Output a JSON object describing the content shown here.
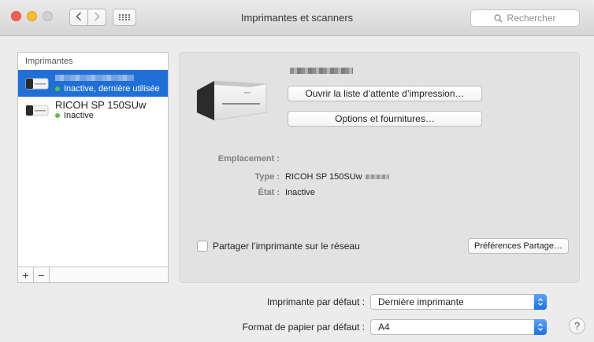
{
  "window": {
    "title": "Imprimantes et scanners",
    "search_placeholder": "Rechercher"
  },
  "printer_list": {
    "header": "Imprimantes",
    "items": [
      {
        "name": "",
        "status": "Inactive, dernière utilisée",
        "selected": true
      },
      {
        "name": "RICOH SP 150SUw",
        "status": "Inactive",
        "selected": false
      }
    ],
    "add_label": "+",
    "remove_label": "−"
  },
  "detail": {
    "open_queue_label": "Ouvrir la liste d’attente d’impression…",
    "options_label": "Options et fournitures…",
    "location_label": "Emplacement :",
    "location_value": "",
    "type_label": "Type :",
    "type_value": "RICOH SP 150SUw",
    "state_label": "État :",
    "state_value": "Inactive",
    "share_label": "Partager l’imprimante sur le réseau",
    "share_checked": false,
    "share_prefs_label": "Préférences Partage…"
  },
  "defaults": {
    "default_printer_label": "Imprimante par défaut :",
    "default_printer_value": "Dernière imprimante",
    "paper_label": "Format de papier par défaut :",
    "paper_value": "A4"
  },
  "help_label": "?",
  "colors": {
    "selection": "#1f6fd6",
    "status_dot": "#5bc236",
    "stepper": "#1a70e8"
  },
  "icons": [
    "back-icon",
    "forward-icon",
    "grid-icon",
    "search-icon",
    "printer-icon",
    "status-dot-icon",
    "stepper-icon",
    "help-icon"
  ]
}
